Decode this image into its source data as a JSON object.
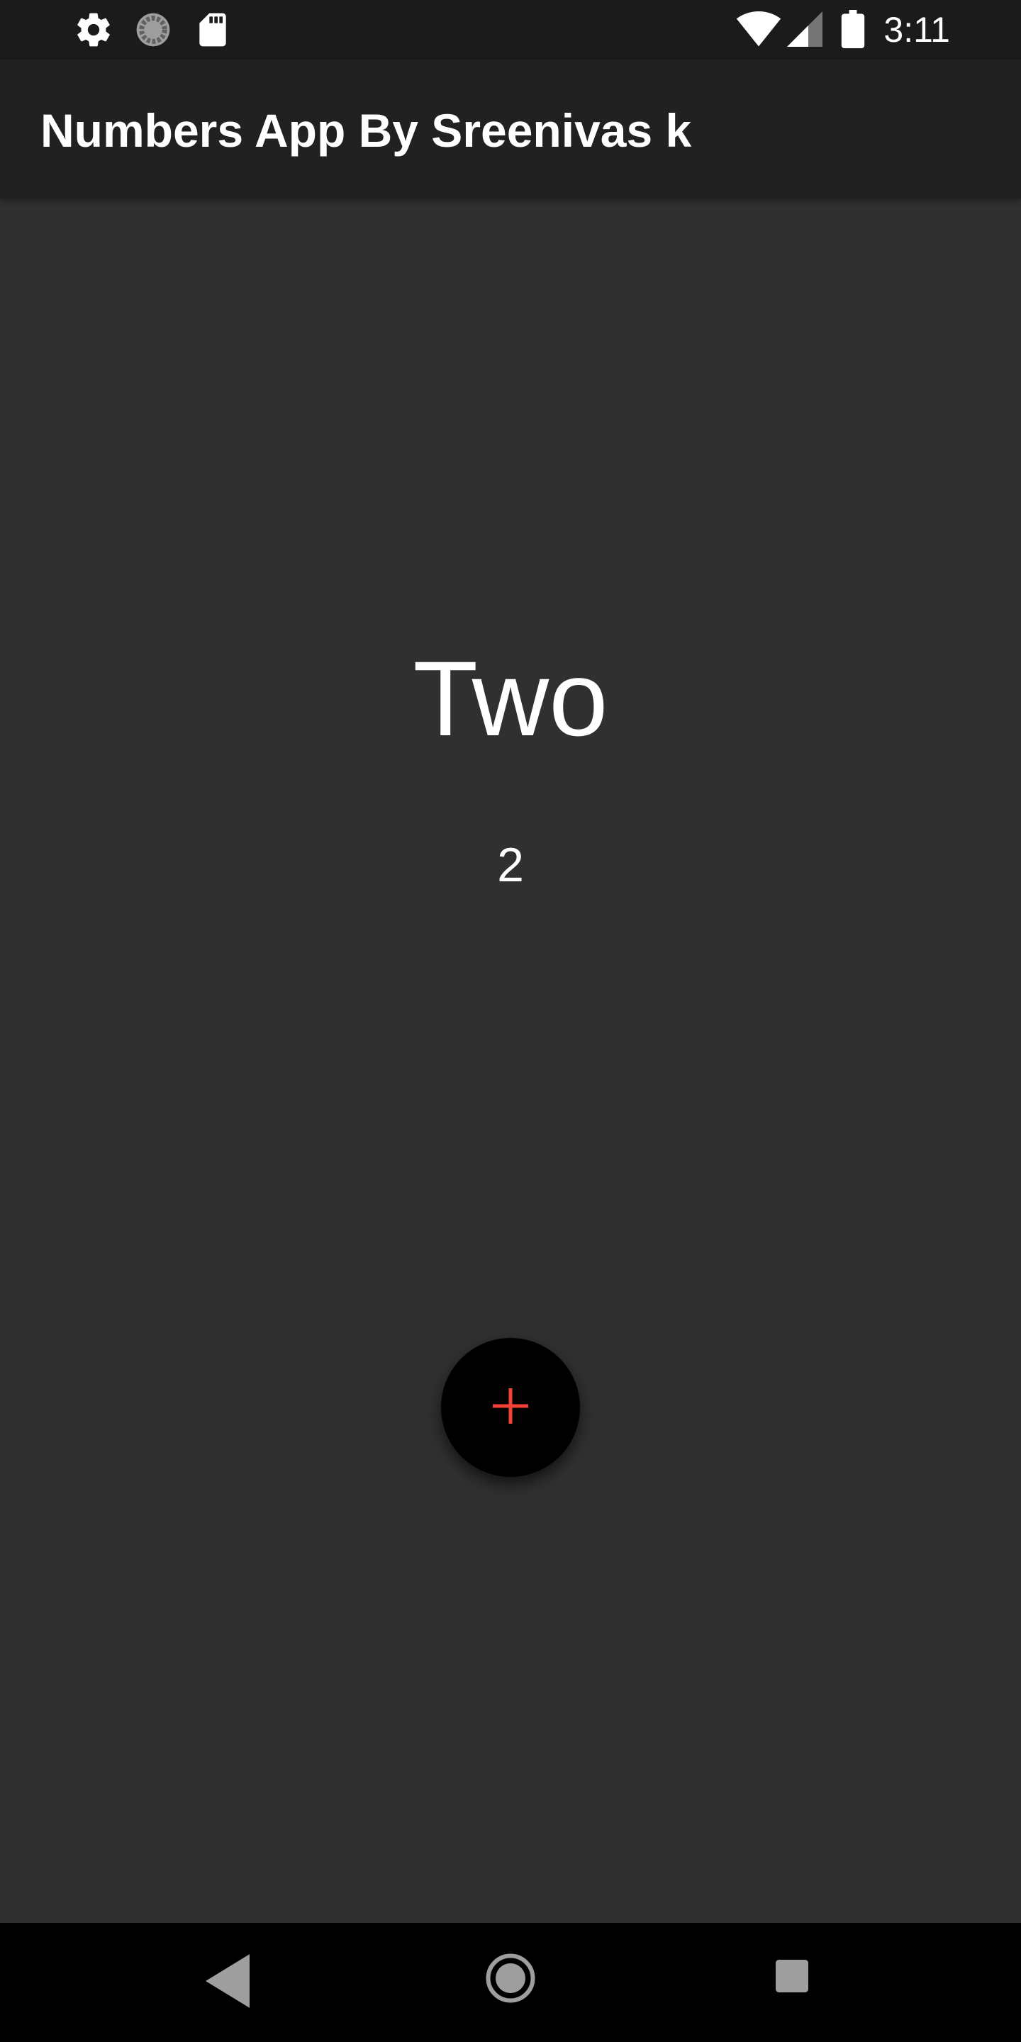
{
  "status_bar": {
    "time": "3:11",
    "left_icons": [
      "gear-icon",
      "sync-progress-icon",
      "sd-card-icon"
    ],
    "right_icons": [
      "wifi-icon",
      "cell-signal-icon",
      "battery-icon"
    ]
  },
  "app_bar": {
    "title": "Numbers App By Sreenivas k"
  },
  "main": {
    "word": "Two",
    "digit": "2",
    "fab": {
      "icon": "plus-icon",
      "icon_color": "#f44336"
    }
  },
  "nav_bar": {
    "buttons": [
      "back-icon",
      "home-icon",
      "recents-icon"
    ]
  },
  "colors": {
    "background": "#303030",
    "app_bar": "#212121",
    "status_bar": "#1b1b1b",
    "accent": "#f44336"
  }
}
